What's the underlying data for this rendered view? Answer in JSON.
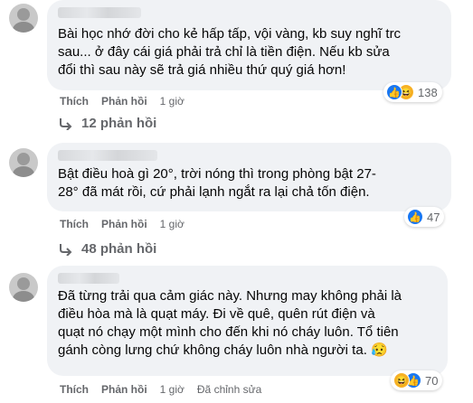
{
  "comments": [
    {
      "text_lines": [
        "Bài học nhớ đời cho kẻ hấp tấp, vội vàng, kb suy nghĩ trc",
        "sau... ở đây cái giá phải trả chỉ là tiền điện. Nếu kb sửa",
        "đổi thì sau này sẽ trả giá nhiều thứ quý giá hơn!"
      ],
      "reaction_count": "138",
      "actions": {
        "like": "Thích",
        "reply": "Phản hồi",
        "time": "1 giờ"
      },
      "replies_label": "12 phản hồi"
    },
    {
      "text_lines": [
        "Bật điều hoà gì 20°, trời nóng thì trong phòng bật 27-",
        "28° đã mát rồi, cứ phải lạnh ngắt ra lại chả tốn điện."
      ],
      "reaction_count": "47",
      "actions": {
        "like": "Thích",
        "reply": "Phản hồi",
        "time": "1 giờ"
      },
      "replies_label": "48 phản hồi"
    },
    {
      "text_lines": [
        "Đã từng trải qua cảm giác này. Nhưng may không phải là",
        "điều hòa mà là quạt máy. Đi về quê, quên rút điện và",
        "quạt nó chạy một mình cho đến khi nó cháy luôn. Tổ tiên",
        "gánh còng lưng chứ không cháy luôn nhà người ta."
      ],
      "emoji_after_text": "😥",
      "reaction_count": "70",
      "actions": {
        "like": "Thích",
        "reply": "Phản hồi",
        "time": "1 giờ",
        "edited": "Đã chỉnh sửa"
      }
    }
  ],
  "colors": {
    "bubble": "#f0f2f5",
    "meta": "#65676b",
    "like_blue": "#1877f2"
  }
}
